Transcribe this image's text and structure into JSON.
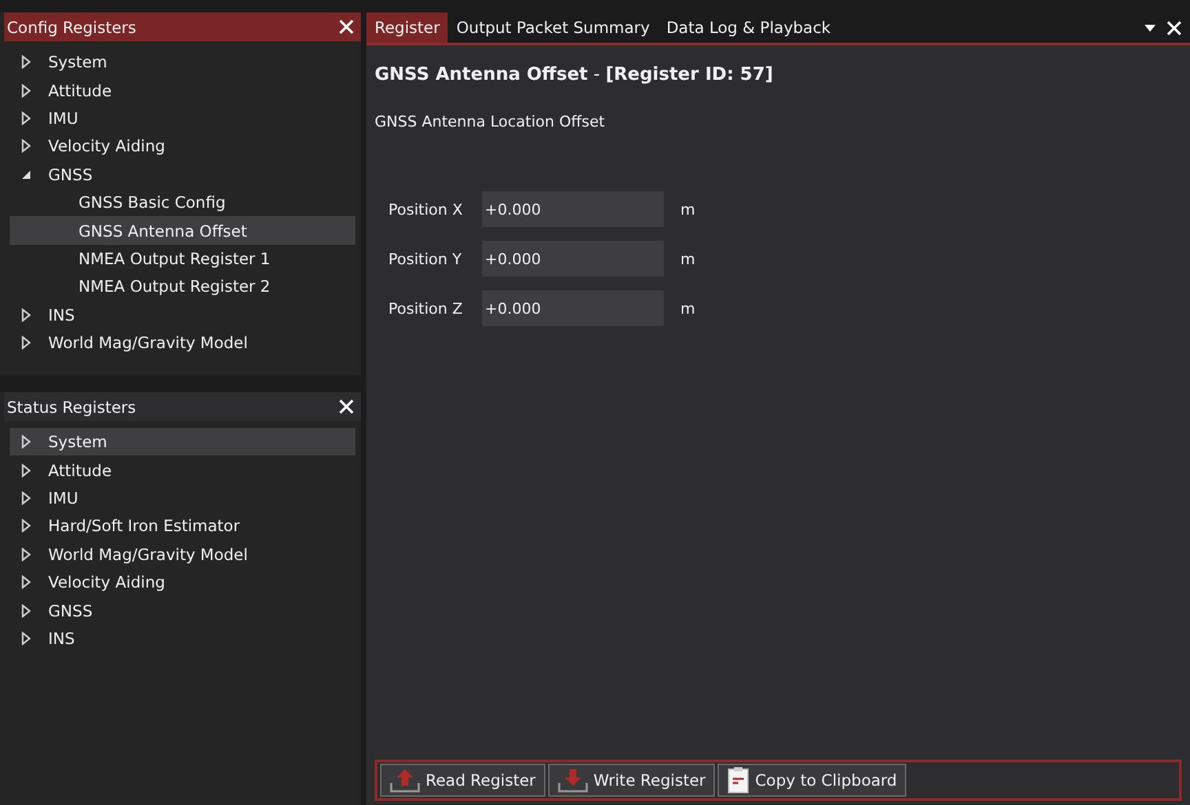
{
  "config_registers": {
    "title": "Config Registers",
    "items": [
      {
        "label": "System",
        "expanded": false,
        "selected": false
      },
      {
        "label": "Attitude",
        "expanded": false,
        "selected": false
      },
      {
        "label": "IMU",
        "expanded": false,
        "selected": false
      },
      {
        "label": "Velocity Aiding",
        "expanded": false,
        "selected": false
      },
      {
        "label": "GNSS",
        "expanded": true,
        "selected": false,
        "children": [
          {
            "label": "GNSS Basic Config",
            "selected": false
          },
          {
            "label": "GNSS Antenna Offset",
            "selected": true
          },
          {
            "label": "NMEA Output Register 1",
            "selected": false
          },
          {
            "label": "NMEA Output Register 2",
            "selected": false
          }
        ]
      },
      {
        "label": "INS",
        "expanded": false,
        "selected": false
      },
      {
        "label": "World Mag/Gravity Model",
        "expanded": false,
        "selected": false
      }
    ]
  },
  "status_registers": {
    "title": "Status Registers",
    "items": [
      {
        "label": "System",
        "expanded": false,
        "selected": true
      },
      {
        "label": "Attitude",
        "expanded": false,
        "selected": false
      },
      {
        "label": "IMU",
        "expanded": false,
        "selected": false
      },
      {
        "label": "Hard/Soft Iron Estimator",
        "expanded": false,
        "selected": false
      },
      {
        "label": "World Mag/Gravity Model",
        "expanded": false,
        "selected": false
      },
      {
        "label": "Velocity Aiding",
        "expanded": false,
        "selected": false
      },
      {
        "label": "GNSS",
        "expanded": false,
        "selected": false
      },
      {
        "label": "INS",
        "expanded": false,
        "selected": false
      }
    ]
  },
  "tabs": [
    {
      "label": "Register",
      "selected": true
    },
    {
      "label": "Output Packet Summary",
      "selected": false
    },
    {
      "label": "Data Log & Playback",
      "selected": false
    }
  ],
  "register": {
    "heading": "**GNSS Antenna Offset** - **[Register ID: 57]**",
    "description": "GNSS Antenna Location Offset",
    "fields": [
      {
        "label": "Position X",
        "value": "+0.000",
        "unit": "m"
      },
      {
        "label": "Position Y",
        "value": "+0.000",
        "unit": "m"
      },
      {
        "label": "Position Z",
        "value": "+0.000",
        "unit": "m"
      }
    ]
  },
  "toolbar": [
    {
      "label": "Read Register",
      "kind": "read"
    },
    {
      "label": "Write Register",
      "kind": "write"
    },
    {
      "label": "Copy to Clipboard",
      "kind": "clipboard"
    }
  ]
}
